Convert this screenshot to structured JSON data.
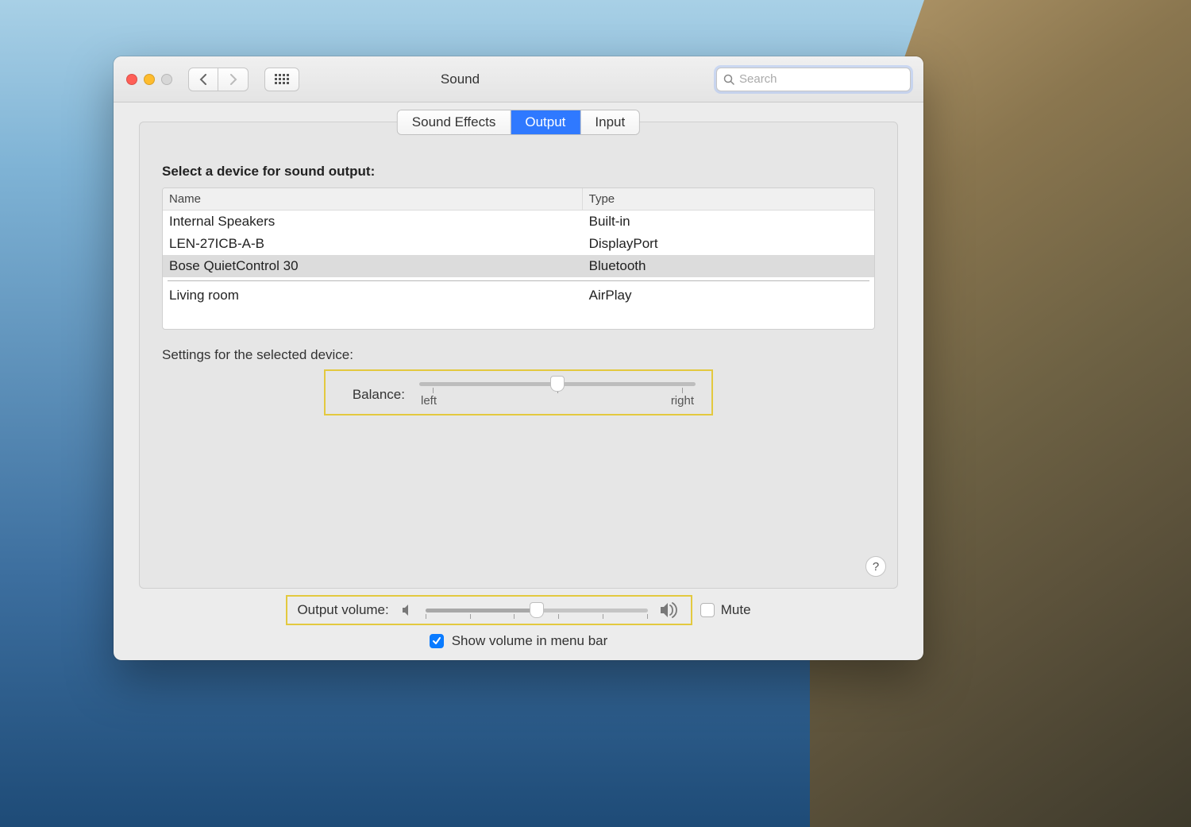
{
  "window": {
    "title": "Sound",
    "search_placeholder": "Search"
  },
  "tabs": {
    "sound_effects": "Sound Effects",
    "output": "Output",
    "input": "Input",
    "active": "output"
  },
  "section": {
    "select_device": "Select a device for sound output:",
    "col_name": "Name",
    "col_type": "Type",
    "devices": [
      {
        "name": "Internal Speakers",
        "type": "Built-in",
        "selected": false
      },
      {
        "name": "LEN-27ICB-A-B",
        "type": "DisplayPort",
        "selected": false
      },
      {
        "name": "Bose QuietControl 30",
        "type": "Bluetooth",
        "selected": true
      }
    ],
    "airplay_devices": [
      {
        "name": "Living room",
        "type": "AirPlay"
      }
    ],
    "settings_title": "Settings for the selected device:",
    "balance_label": "Balance:",
    "balance_left": "left",
    "balance_right": "right",
    "balance_value": 0.5
  },
  "footer": {
    "output_volume_label": "Output volume:",
    "volume_value": 0.5,
    "mute_label": "Mute",
    "mute_checked": false,
    "show_in_menu_label": "Show volume in menu bar",
    "show_in_menu_checked": true
  }
}
